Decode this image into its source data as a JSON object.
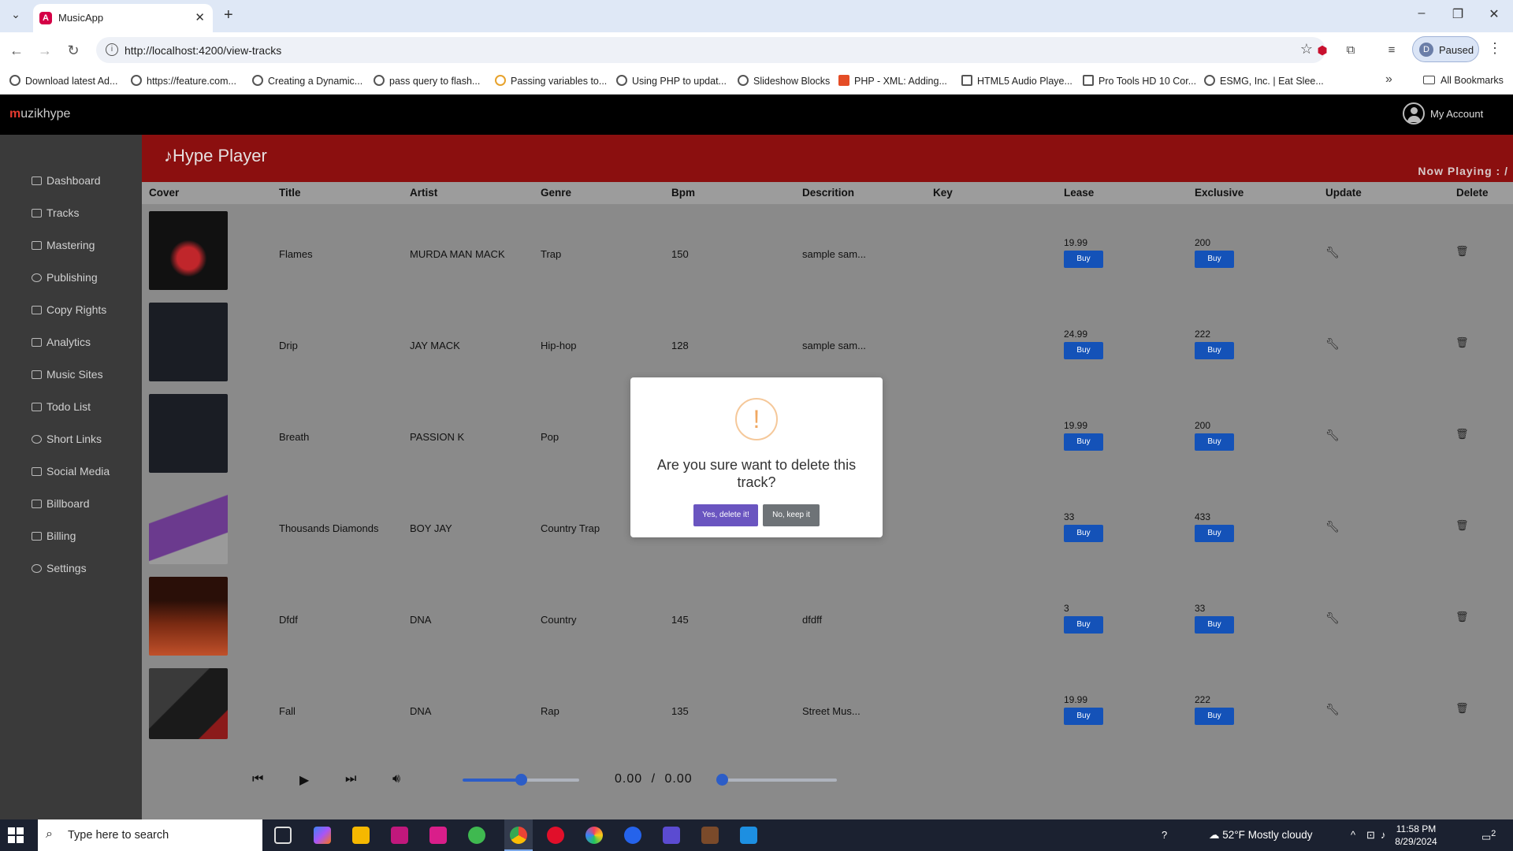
{
  "browser": {
    "tab_title": "MusicApp",
    "url": "http://localhost:4200/view-tracks",
    "profile_initial": "D",
    "profile_label": "Paused",
    "bookmarks": [
      "Download latest Ad...",
      "https://feature.com...",
      "Creating a Dynamic...",
      "pass query to flash...",
      "Passing variables to...",
      "Using PHP to updat...",
      "Slideshow Blocks",
      "PHP - XML: Adding...",
      "HTML5 Audio Playe...",
      "Pro Tools HD 10 Cor...",
      "ESMG, Inc. | Eat Slee..."
    ],
    "all_bookmarks": "All Bookmarks"
  },
  "app": {
    "brand_m": "m",
    "brand_rest": "uzikhype",
    "account_label": "My Account"
  },
  "sidebar": {
    "items": [
      "Dashboard",
      "Tracks",
      "Mastering",
      "Publishing",
      "Copy Rights",
      "Analytics",
      "Music Sites",
      "Todo List",
      "Short Links",
      "Social Media",
      "Billboard",
      "Billing",
      "Settings"
    ]
  },
  "player": {
    "title": "Hype Player",
    "now_playing": "Now Playing : /",
    "time_current": "0.00",
    "time_separator": "/",
    "time_total": "0.00",
    "volume_level": 0.5,
    "progress_level": 0
  },
  "table": {
    "headers": [
      "Cover",
      "Title",
      "Artist",
      "Genre",
      "Bpm",
      "Descrition",
      "Key",
      "Lease",
      "Exclusive",
      "Update",
      "Delete"
    ],
    "buy_label": "Buy",
    "rows": [
      {
        "title": "Flames",
        "artist": "MURDA MAN MACK",
        "genre": "Trap",
        "bpm": "150",
        "description": "sample sam...",
        "key": "",
        "lease": "19.99",
        "exclusive": "200"
      },
      {
        "title": "Drip",
        "artist": "JAY MACK",
        "genre": "Hip-hop",
        "bpm": "128",
        "description": "sample sam...",
        "key": "",
        "lease": "24.99",
        "exclusive": "222"
      },
      {
        "title": "Breath",
        "artist": "PASSION K",
        "genre": "Pop",
        "bpm": "",
        "description": "",
        "key": "",
        "lease": "19.99",
        "exclusive": "200"
      },
      {
        "title": "Thousands Diamonds",
        "artist": "BOY JAY",
        "genre": "Country Trap",
        "bpm": "",
        "description": "",
        "key": "",
        "lease": "33",
        "exclusive": "433"
      },
      {
        "title": "Dfdf",
        "artist": "DNA",
        "genre": "Country",
        "bpm": "145",
        "description": "dfdff",
        "key": "",
        "lease": "3",
        "exclusive": "33"
      },
      {
        "title": "Fall",
        "artist": "DNA",
        "genre": "Rap",
        "bpm": "135",
        "description": "Street Mus...",
        "key": "",
        "lease": "19.99",
        "exclusive": "222"
      }
    ]
  },
  "modal": {
    "icon": "!",
    "title": "Are you sure want to delete this track?",
    "confirm_label": "Yes, delete it!",
    "cancel_label": "No, keep it"
  },
  "taskbar": {
    "search_placeholder": "Type here to search",
    "temperature": "52°F",
    "weather": "Mostly cloudy",
    "time": "11:58 PM",
    "date": "8/29/2024",
    "notifications": "2"
  },
  "colors": {
    "brand_red": "#8b0f0f",
    "buy_blue": "#1452b8",
    "confirm_purple": "#6a55c0",
    "cancel_gray": "#6e7377"
  }
}
